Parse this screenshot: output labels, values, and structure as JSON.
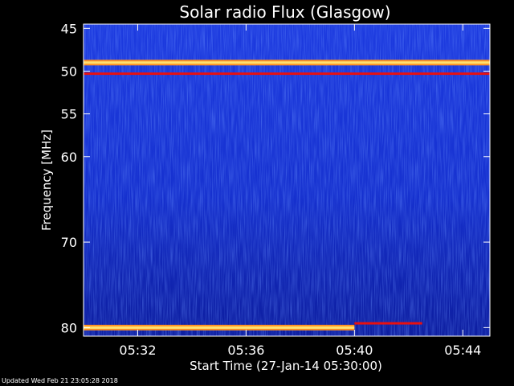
{
  "chart_data": {
    "type": "heatmap",
    "title": "Solar radio Flux (Glasgow)",
    "xlabel": "Start Time (27-Jan-14 05:30:00)",
    "ylabel": "Frequency [MHz]",
    "x_ticks": [
      "05:32",
      "05:36",
      "05:40",
      "05:44"
    ],
    "x_tick_minutes": [
      2,
      6,
      10,
      14
    ],
    "x_range_minutes": [
      0,
      15
    ],
    "y_ticks": [
      45,
      50,
      55,
      60,
      70,
      80
    ],
    "y_range": [
      44.5,
      81
    ],
    "colors": {
      "background": "#000000",
      "low": "#0a1aa8",
      "mid": "#1f3fe8",
      "high": "#ff9020",
      "peak": "#ffe070",
      "red": "#e81010"
    },
    "features": [
      {
        "kind": "band",
        "freq": 49.0,
        "intensity": "peak"
      },
      {
        "kind": "band",
        "freq": 50.3,
        "intensity": "red"
      },
      {
        "kind": "band",
        "freq": 80.0,
        "intensity": "peak",
        "t_end_minutes": 10.0
      },
      {
        "kind": "band",
        "freq": 79.5,
        "intensity": "red",
        "t_start_minutes": 10.0,
        "t_end_minutes": 12.5
      }
    ]
  },
  "footer": {
    "updated": "Updated Wed Feb 21 23:05:28 2018"
  }
}
